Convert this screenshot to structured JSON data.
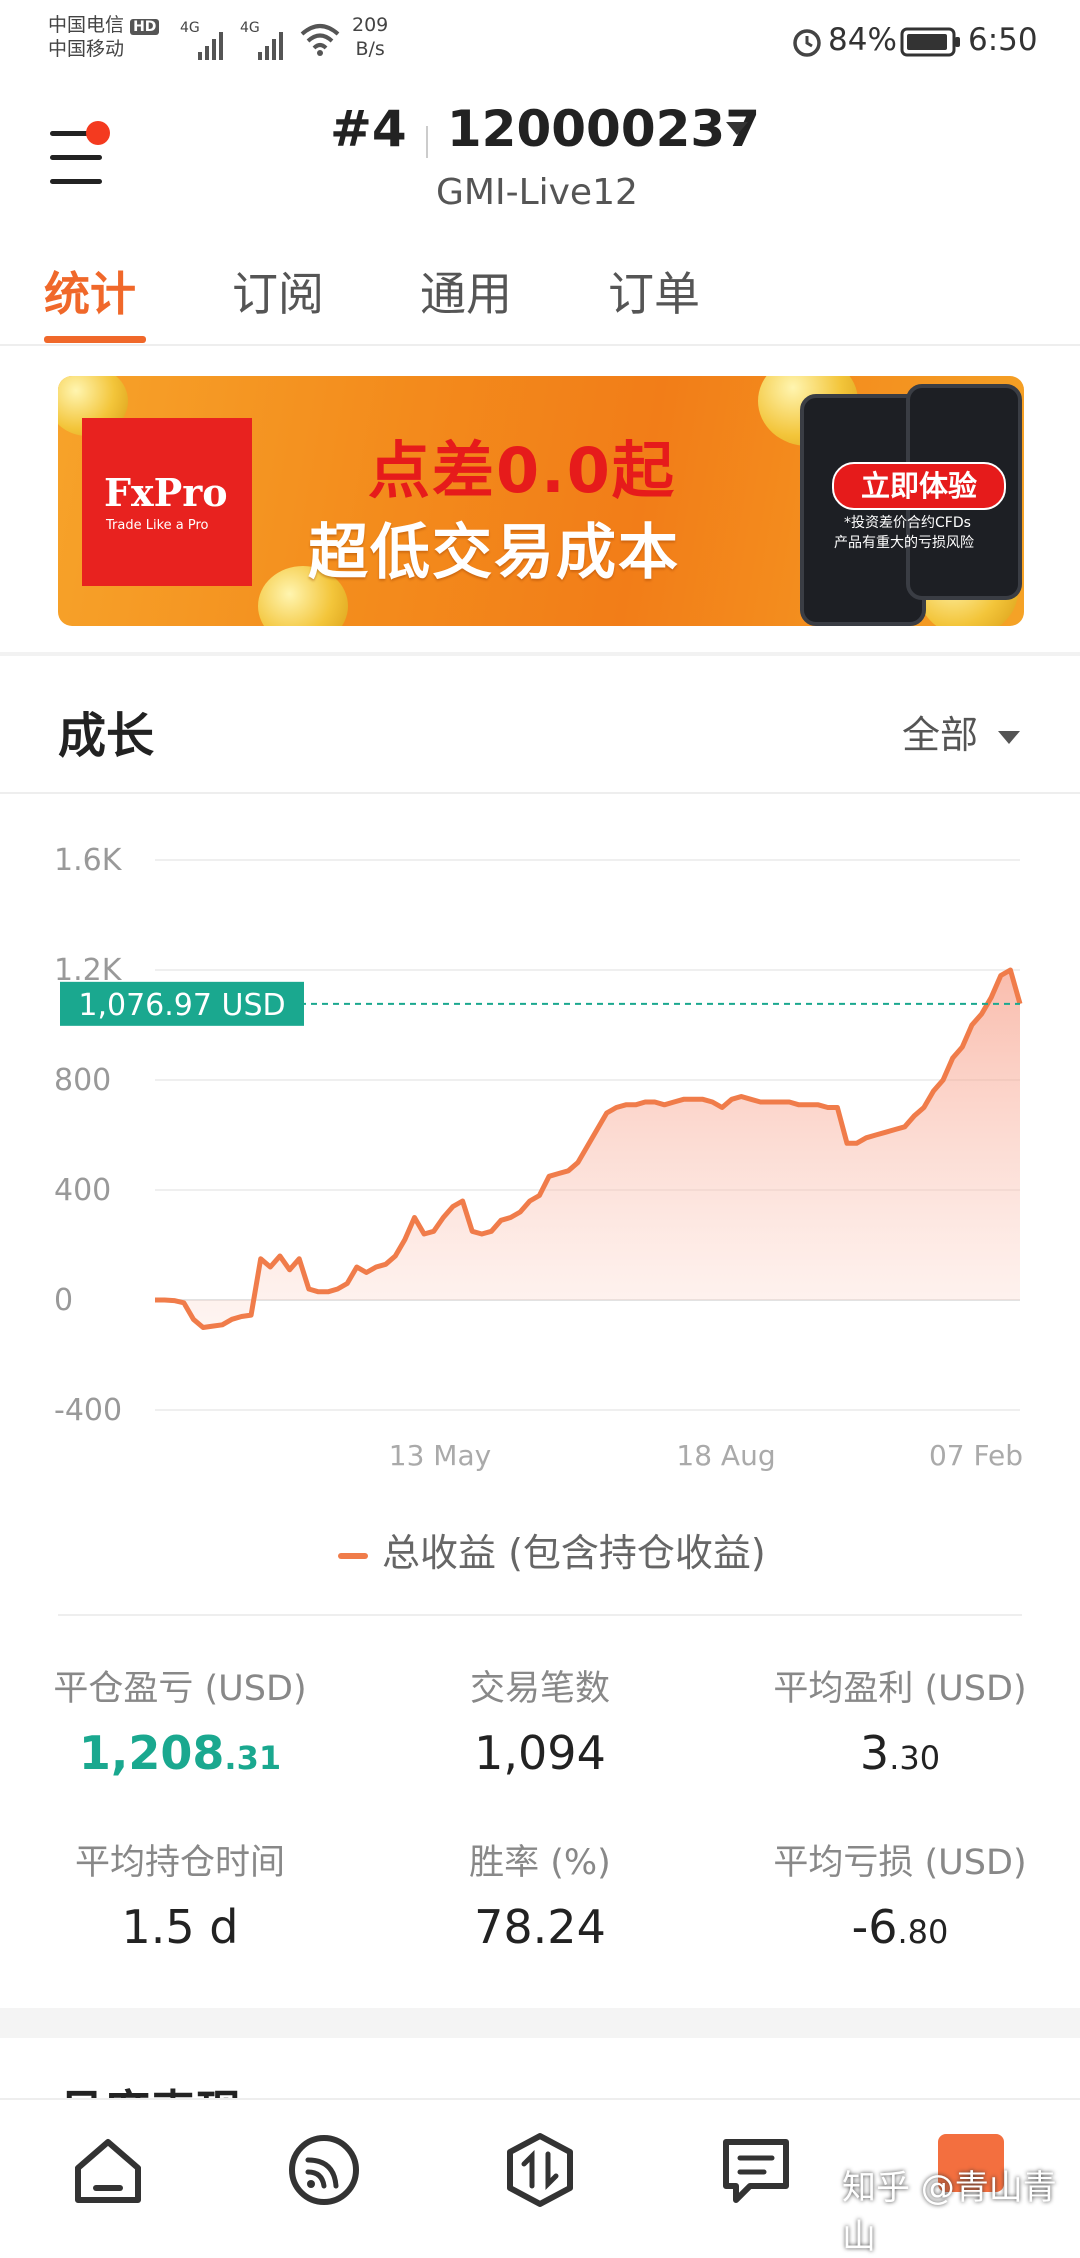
{
  "status_bar": {
    "carrier1": "中国电信",
    "carrier1_badge": "HD",
    "carrier2": "中国移动",
    "signal1": "4G",
    "signal2": "4G",
    "net_speed_value": "209",
    "net_speed_unit": "B/s",
    "battery": "84%",
    "time": "6:50"
  },
  "header": {
    "account_prefix": "#4",
    "account_number": "120000237",
    "server": "GMI-Live12"
  },
  "tabs": [
    {
      "label": "统计",
      "active": true
    },
    {
      "label": "订阅",
      "active": false
    },
    {
      "label": "通用",
      "active": false
    },
    {
      "label": "订单",
      "active": false
    }
  ],
  "banner": {
    "brand": "FxPro",
    "brand_tagline": "Trade Like a Pro",
    "headline1": "点差0.0起",
    "headline2": "超低交易成本",
    "cta": "立即体验",
    "disclaimer1": "*投资差价合约CFDs",
    "disclaimer2": "产品有重大的亏损风险"
  },
  "growth": {
    "title": "成长",
    "filter": "全部"
  },
  "chart_data": {
    "type": "area",
    "y_ticks": [
      "1.6K",
      "1.2K",
      "800",
      "400",
      "0",
      "-400"
    ],
    "ylim": [
      -400,
      1600
    ],
    "x_ticks": [
      "13 May",
      "18 Aug",
      "07 Feb"
    ],
    "current_value_label": "1,076.97 USD",
    "current_value": 1076.97,
    "line_color": "#f07c4a",
    "marker_color": "#1aa88f",
    "series": [
      {
        "name": "总收益 (包含持仓收益)",
        "values": [
          0,
          0,
          -2,
          -10,
          -70,
          -100,
          -95,
          -90,
          -70,
          -60,
          -55,
          150,
          120,
          160,
          110,
          150,
          40,
          30,
          30,
          40,
          60,
          120,
          100,
          120,
          130,
          160,
          220,
          300,
          240,
          250,
          300,
          340,
          360,
          250,
          240,
          250,
          290,
          300,
          320,
          360,
          380,
          450,
          460,
          470,
          500,
          560,
          620,
          680,
          700,
          710,
          710,
          720,
          720,
          710,
          720,
          730,
          730,
          730,
          720,
          700,
          730,
          740,
          730,
          720,
          720,
          720,
          720,
          710,
          710,
          710,
          700,
          700,
          570,
          570,
          590,
          600,
          610,
          620,
          630,
          670,
          700,
          760,
          800,
          880,
          920,
          1000,
          1040,
          1100,
          1180,
          1200,
          1076.97
        ]
      }
    ],
    "legend": "总收益 (包含持仓收益)"
  },
  "stats": [
    {
      "label": "平仓盈亏 (USD)",
      "int": "1,208",
      "dec": ".31",
      "color": "#1aa88f"
    },
    {
      "label": "交易笔数",
      "int": "1,094",
      "dec": "",
      "color": "#222222"
    },
    {
      "label": "平均盈利 (USD)",
      "int": "3",
      "dec": ".30",
      "color": "#222222"
    },
    {
      "label": "平均持仓时间",
      "int": "1.5 d",
      "dec": "",
      "color": "#222222"
    },
    {
      "label": "胜率 (%)",
      "int": "78.24",
      "dec": "",
      "color": "#222222"
    },
    {
      "label": "平均亏损 (USD)",
      "int": "-6",
      "dec": ".80",
      "color": "#222222"
    }
  ],
  "next_section_title": "月度表现",
  "bottom_nav": [
    {
      "icon": "home-icon"
    },
    {
      "icon": "signal-icon"
    },
    {
      "icon": "trade-icon"
    },
    {
      "icon": "news-icon"
    },
    {
      "icon": "calendar-icon"
    }
  ],
  "watermark": "知乎 @青山青山",
  "colors": {
    "accent": "#f0682a",
    "positive": "#1aa88f"
  }
}
